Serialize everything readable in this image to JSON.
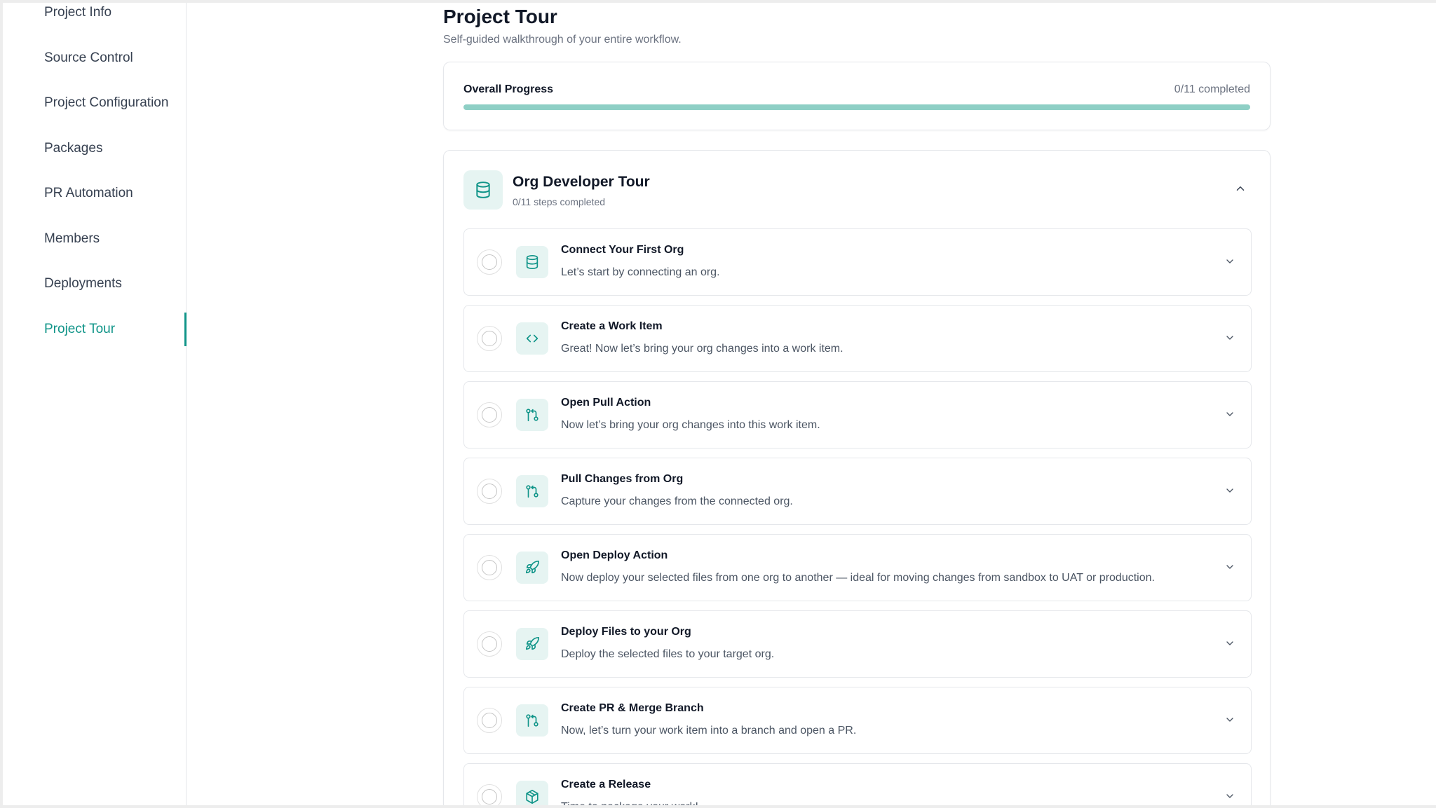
{
  "sidebar": {
    "items": [
      {
        "label": "Project Info"
      },
      {
        "label": "Source Control"
      },
      {
        "label": "Project Configuration"
      },
      {
        "label": "Packages"
      },
      {
        "label": "PR Automation"
      },
      {
        "label": "Members"
      },
      {
        "label": "Deployments"
      },
      {
        "label": "Project Tour",
        "active": true
      }
    ]
  },
  "page": {
    "title": "Project Tour",
    "subtitle": "Self-guided walkthrough of your entire workflow."
  },
  "progress": {
    "label": "Overall Progress",
    "count_text": "0/11 completed",
    "completed": 0,
    "total": 11
  },
  "tour": {
    "title": "Org Developer Tour",
    "subtitle": "0/11 steps completed",
    "icon": "database-icon",
    "steps": [
      {
        "title": "Connect Your First Org",
        "desc": "Let’s start by connecting an org.",
        "icon": "database-icon"
      },
      {
        "title": "Create a Work Item",
        "desc": "Great! Now let’s bring your org changes into a work item.",
        "icon": "code-icon"
      },
      {
        "title": "Open Pull Action",
        "desc": "Now let’s bring your org changes into this work item.",
        "icon": "git-pull-request-icon"
      },
      {
        "title": "Pull Changes from Org",
        "desc": "Capture your changes from the connected org.",
        "icon": "git-pull-request-icon"
      },
      {
        "title": "Open Deploy Action",
        "desc": "Now deploy your selected files from one org to another — ideal for moving changes from sandbox to UAT or production.",
        "icon": "rocket-icon"
      },
      {
        "title": "Deploy Files to your Org",
        "desc": "Deploy the selected files to your target org.",
        "icon": "rocket-icon"
      },
      {
        "title": "Create PR & Merge Branch",
        "desc": "Now, let’s turn your work item into a branch and open a PR.",
        "icon": "git-pull-request-icon"
      },
      {
        "title": "Create a Release",
        "desc": "Time to package your work!",
        "icon": "package-icon"
      }
    ]
  },
  "colors": {
    "accent": "#0f9488",
    "accent_light": "#e6f4f2",
    "progress_track": "#8ecfc5"
  }
}
